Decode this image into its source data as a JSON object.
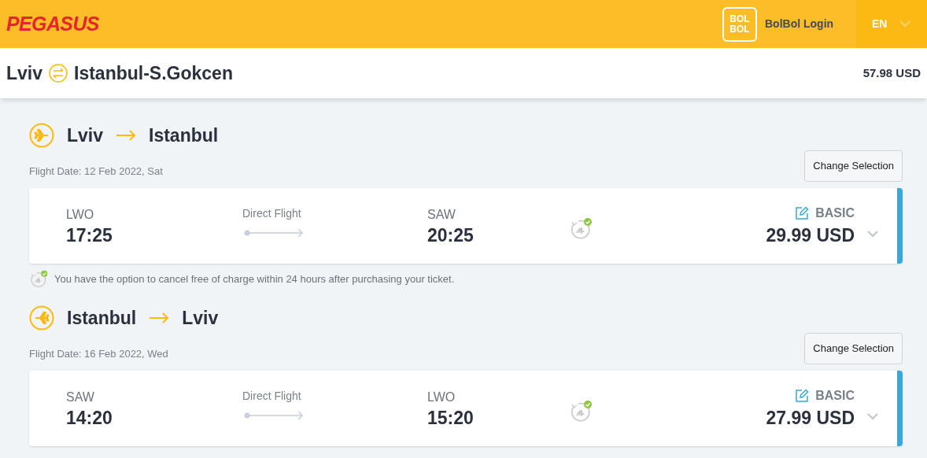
{
  "header": {
    "logo": "PEGASUS",
    "bolbol_badge": [
      "BOL",
      "BOL"
    ],
    "login": "BolBol Login",
    "language": "EN"
  },
  "route_bar": {
    "origin": "Lviv",
    "destination": "Istanbul-S.Gokcen",
    "total": "57.98 USD"
  },
  "flights": [
    {
      "kind": "outbound",
      "from": "Lviv",
      "to": "Istanbul",
      "date": "Flight Date: 12 Feb 2022, Sat",
      "change_button": "Change Selection",
      "dep_code": "LWO",
      "dep_time": "17:25",
      "stop_label": "Direct Flight",
      "arr_code": "SAW",
      "arr_time": "20:25",
      "fare": "BASIC",
      "price": "29.99 USD",
      "note": "You have the option to cancel free of charge within 24 hours after purchasing your ticket."
    },
    {
      "kind": "return",
      "from": "Istanbul",
      "to": "Lviv",
      "date": "Flight Date: 16 Feb 2022, Wed",
      "change_button": "Change Selection",
      "dep_code": "SAW",
      "dep_time": "14:20",
      "stop_label": "Direct Flight",
      "arr_code": "LWO",
      "arr_time": "15:20",
      "fare": "BASIC",
      "price": "27.99 USD"
    }
  ]
}
